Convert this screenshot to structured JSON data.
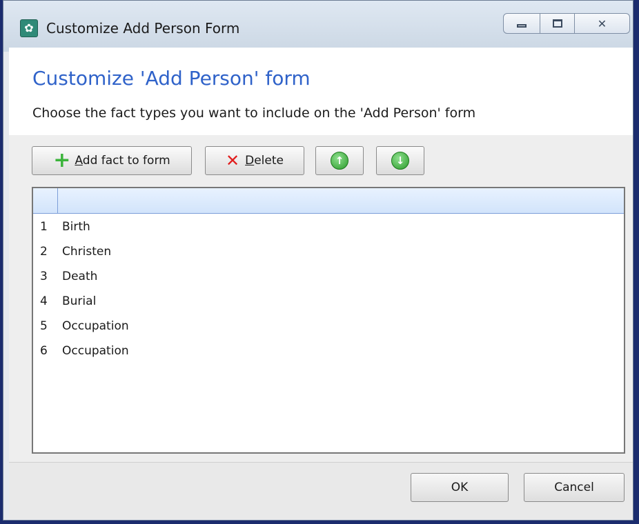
{
  "window": {
    "title": "Customize Add Person Form",
    "caption_buttons": {
      "minimize_icon": "minimize-icon",
      "maximize_icon": "maximize-icon",
      "close_glyph": "✕"
    }
  },
  "header": {
    "heading": "Customize 'Add Person' form",
    "subheading": "Choose the fact types you want to include on the 'Add Person' form"
  },
  "toolbar": {
    "add_label_accel": "A",
    "add_label_rest": "dd fact to form",
    "delete_label_accel": "D",
    "delete_label_rest": "elete",
    "move_up_icon": "arrow-up-circle-icon",
    "move_down_icon": "arrow-down-circle-icon"
  },
  "grid": {
    "rows": [
      {
        "num": "1",
        "name": "Birth"
      },
      {
        "num": "2",
        "name": "Christen"
      },
      {
        "num": "3",
        "name": "Death"
      },
      {
        "num": "4",
        "name": "Burial"
      },
      {
        "num": "5",
        "name": "Occupation"
      },
      {
        "num": "6",
        "name": "Occupation"
      }
    ]
  },
  "footer": {
    "ok_label": "OK",
    "cancel_label": "Cancel"
  },
  "colors": {
    "heading": "#2f62c9",
    "add_icon": "#3bb43b",
    "delete_icon": "#e11d1d",
    "arrow_icon": "#2a9a2a"
  }
}
